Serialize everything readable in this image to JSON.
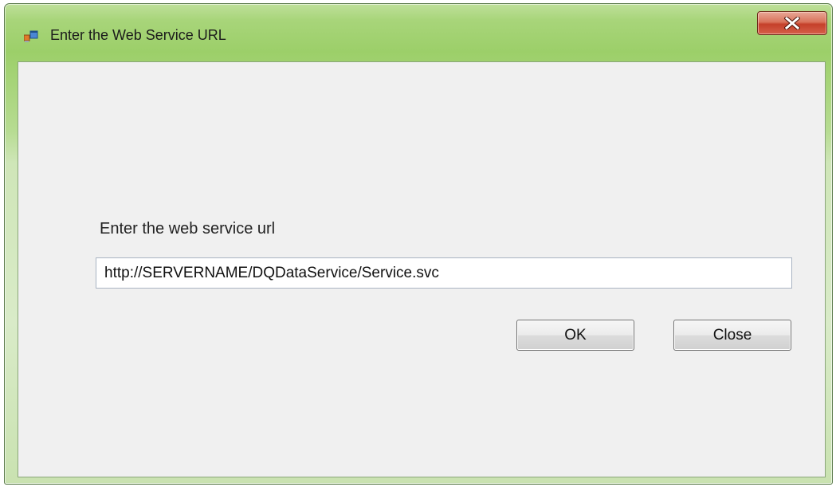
{
  "window": {
    "title": "Enter the Web Service URL",
    "close_icon": "close-x-icon",
    "app_icon": "windows-form-icon"
  },
  "form": {
    "prompt_label": "Enter the web service url",
    "url_value": "http://SERVERNAME/DQDataService/Service.svc"
  },
  "buttons": {
    "ok_label": "OK",
    "close_label": "Close"
  },
  "colors": {
    "titlebar_accent": "#a8d57a",
    "client_background": "#f0f0f0",
    "close_button": "#c5402a"
  }
}
